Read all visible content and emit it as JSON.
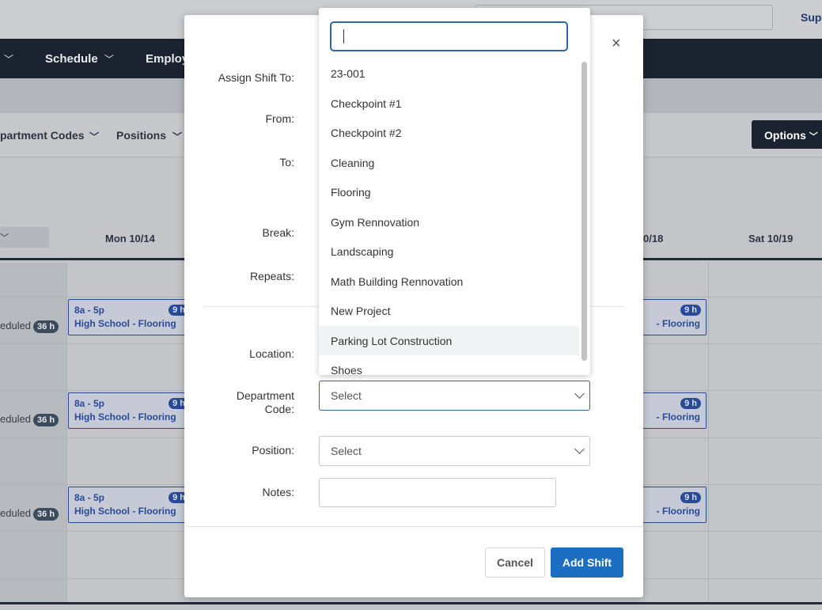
{
  "background": {
    "support_link": "Sup",
    "nav": [
      {
        "label": "Schedule"
      },
      {
        "label": "Employ"
      }
    ],
    "filters": {
      "dept_codes": "partment Codes",
      "positions": "Positions"
    },
    "options_button": "Options",
    "days": [
      "Mon 10/14",
      "0/18",
      "Sat 10/19"
    ],
    "scheduled_label": "eduled",
    "scheduled_hours": "36 h",
    "shift": {
      "time": "8a - 5p",
      "hours": "9 h",
      "title": "High School - Flooring",
      "title_right": "- Flooring"
    }
  },
  "modal": {
    "labels": {
      "assign_to": "Assign Shift To:",
      "from": "From:",
      "to": "To:",
      "break": "Break:",
      "repeats": "Repeats:",
      "location": "Location:",
      "department_code_line1": "Department",
      "department_code_line2": "Code:",
      "position": "Position:",
      "notes": "Notes:"
    },
    "department_code_select": "Select",
    "position_select": "Select",
    "cancel_button": "Cancel",
    "add_shift_button": "Add Shift",
    "close_glyph": "×"
  },
  "dropdown": {
    "search_value": "",
    "items": [
      "23-001",
      "Checkpoint #1",
      "Checkpoint #2",
      "Cleaning",
      "Flooring",
      "Gym Rennovation",
      "Landscaping",
      "Math Building Rennovation",
      "New Project",
      "Parking Lot Construction",
      "Shoes"
    ],
    "highlighted_index": 9
  },
  "colors": {
    "primary": "#1b6ec2",
    "focus": "#2e64ad",
    "nav_dark": "#1b2331"
  }
}
